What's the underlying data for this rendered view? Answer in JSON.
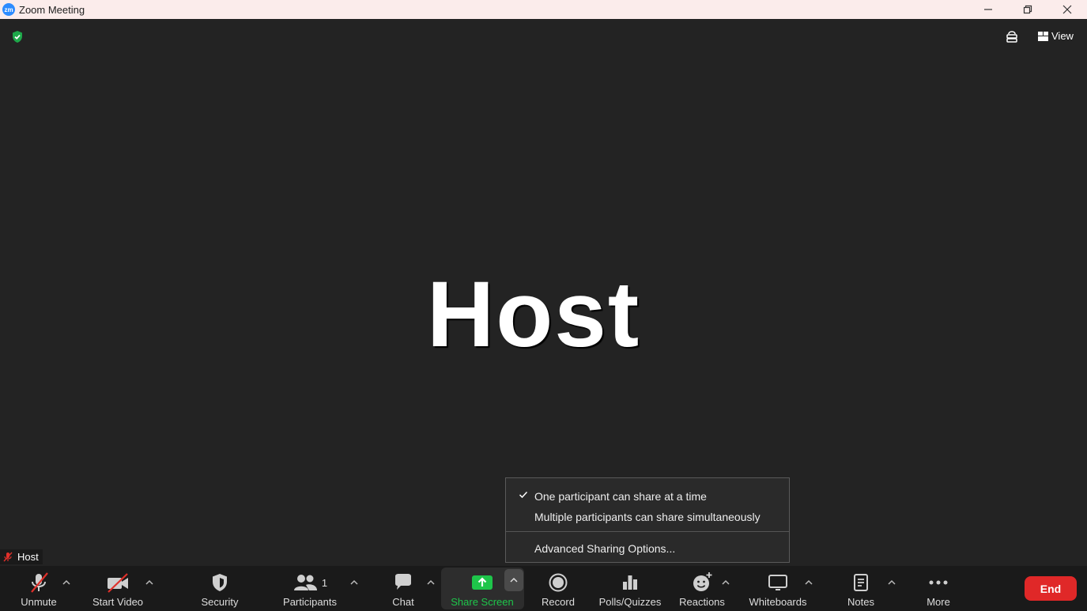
{
  "window": {
    "title": "Zoom Meeting",
    "logo_text": "zm"
  },
  "header": {
    "view_label": "View"
  },
  "video": {
    "participant_name_big": "Host",
    "name_tag": "Host"
  },
  "share_menu": {
    "option_one": "One participant can share at a time",
    "option_one_checked": true,
    "option_multi": "Multiple participants can share simultaneously",
    "advanced": "Advanced Sharing Options..."
  },
  "toolbar": {
    "unmute": "Unmute",
    "start_video": "Start Video",
    "security": "Security",
    "participants": "Participants",
    "participants_count": "1",
    "chat": "Chat",
    "share_screen": "Share Screen",
    "record": "Record",
    "polls": "Polls/Quizzes",
    "reactions": "Reactions",
    "whiteboards": "Whiteboards",
    "notes": "Notes",
    "more": "More",
    "end": "End"
  },
  "colors": {
    "background": "#232323",
    "toolbar": "#1a1a1a",
    "share_green": "#1ec54a",
    "end_red": "#e02828",
    "security_green": "#1ea84a",
    "muted_red": "#e0302a"
  }
}
